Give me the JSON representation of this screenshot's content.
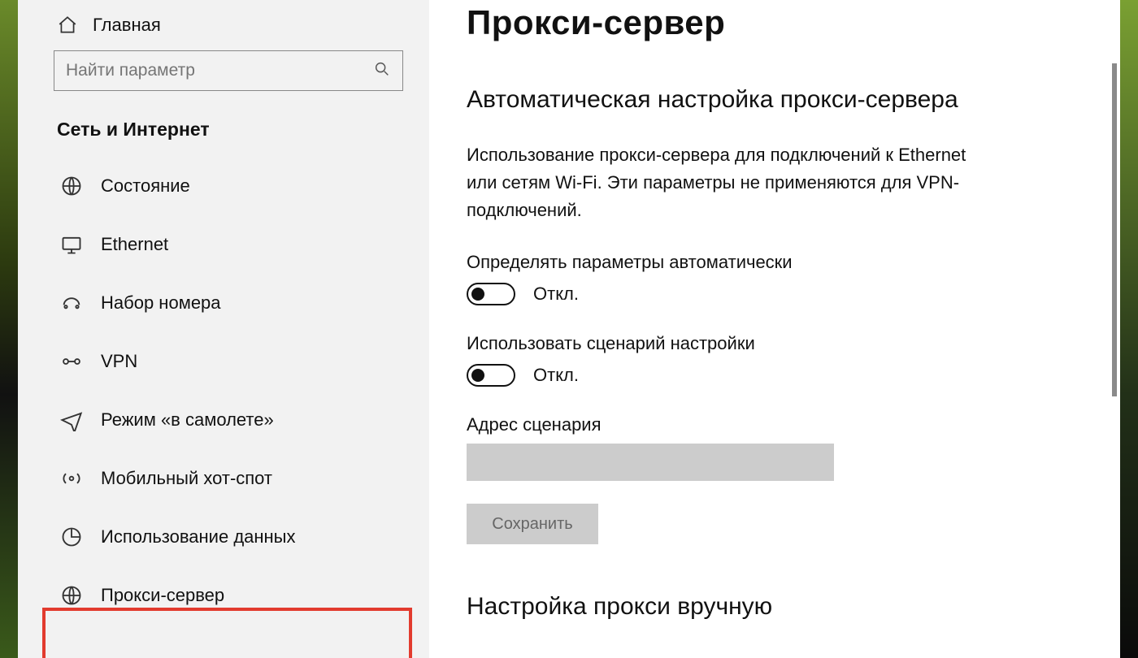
{
  "sidebar": {
    "home_label": "Главная",
    "search_placeholder": "Найти параметр",
    "category": "Сеть и Интернет",
    "items": [
      {
        "id": "status",
        "label": "Состояние"
      },
      {
        "id": "ethernet",
        "label": "Ethernet"
      },
      {
        "id": "dialup",
        "label": "Набор номера"
      },
      {
        "id": "vpn",
        "label": "VPN"
      },
      {
        "id": "airplane",
        "label": "Режим «в самолете»"
      },
      {
        "id": "hotspot",
        "label": "Мобильный хот-спот"
      },
      {
        "id": "datausage",
        "label": "Использование данных"
      },
      {
        "id": "proxy",
        "label": "Прокси-сервер"
      }
    ],
    "highlighted_index": 7
  },
  "main": {
    "title": "Прокси-сервер",
    "auto_section_title": "Автоматическая настройка прокси-сервера",
    "auto_description": "Использование прокси-сервера для подключений к Ethernet или сетям Wi-Fi. Эти параметры не применяются для VPN-подключений.",
    "detect_label": "Определять параметры автоматически",
    "detect_state": "Откл.",
    "detect_on": false,
    "use_script_label": "Использовать сценарий настройки",
    "use_script_state": "Откл.",
    "use_script_on": false,
    "script_address_label": "Адрес сценария",
    "script_address_value": "",
    "save_label": "Сохранить",
    "manual_section_title": "Настройка прокси вручную"
  }
}
